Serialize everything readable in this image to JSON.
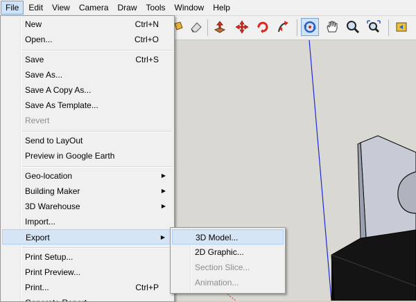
{
  "menubar": {
    "items": [
      "File",
      "Edit",
      "View",
      "Camera",
      "Draw",
      "Tools",
      "Window",
      "Help"
    ],
    "active": "File"
  },
  "toolbar": {
    "icons": [
      "paint-bucket-icon",
      "eraser-icon",
      "push-pull-icon",
      "move-icon",
      "rotate-icon",
      "follow-me-icon",
      "orbit-icon",
      "pan-icon",
      "zoom-icon",
      "zoom-extents-icon",
      "previous-view-icon"
    ],
    "selected": "orbit-icon"
  },
  "file_menu": {
    "items": [
      {
        "label": "New",
        "shortcut": "Ctrl+N"
      },
      {
        "label": "Open...",
        "shortcut": "Ctrl+O"
      },
      {
        "label": "Save",
        "shortcut": "Ctrl+S"
      },
      {
        "label": "Save As...",
        "shortcut": ""
      },
      {
        "label": "Save A Copy As...",
        "shortcut": ""
      },
      {
        "label": "Save As Template...",
        "shortcut": ""
      },
      {
        "label": "Revert",
        "shortcut": ""
      },
      {
        "label": "Send to LayOut",
        "shortcut": ""
      },
      {
        "label": "Preview in Google Earth",
        "shortcut": ""
      },
      {
        "label": "Geo-location",
        "shortcut": ""
      },
      {
        "label": "Building Maker",
        "shortcut": ""
      },
      {
        "label": "3D Warehouse",
        "shortcut": ""
      },
      {
        "label": "Import...",
        "shortcut": ""
      },
      {
        "label": "Export",
        "shortcut": ""
      },
      {
        "label": "Print Setup...",
        "shortcut": ""
      },
      {
        "label": "Print Preview...",
        "shortcut": ""
      },
      {
        "label": "Print...",
        "shortcut": "Ctrl+P"
      },
      {
        "label": "Generate Report...",
        "shortcut": ""
      }
    ],
    "disabled": [
      "Revert"
    ],
    "submenu_items": [
      "Geo-location",
      "Building Maker",
      "3D Warehouse",
      "Export"
    ],
    "highlighted": "Export"
  },
  "export_menu": {
    "items": [
      {
        "label": "3D Model..."
      },
      {
        "label": "2D Graphic..."
      },
      {
        "label": "Section Slice..."
      },
      {
        "label": "Animation..."
      }
    ],
    "disabled": [
      "Section Slice...",
      "Animation..."
    ],
    "highlighted": "3D Model..."
  },
  "colors": {
    "menu_bg": "#f0f0f0",
    "highlight": "#d6e5f5",
    "axis_blue": "#1c2ad6",
    "viewport_bg": "#d9d8d3",
    "model_face": "#c6cbd6",
    "model_dark": "#141414"
  }
}
